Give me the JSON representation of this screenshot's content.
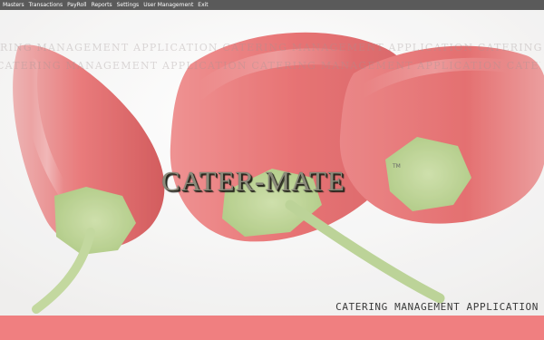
{
  "menu": {
    "items": [
      {
        "label": "Masters"
      },
      {
        "label": "Transactions"
      },
      {
        "label": "PayRoll"
      },
      {
        "label": "Reports"
      },
      {
        "label": "Settings"
      },
      {
        "label": "User Management"
      },
      {
        "label": "Exit"
      }
    ]
  },
  "branding": {
    "logo_text": "CATER-MATE",
    "trademark": "TM",
    "tagline": "CATERING MANAGEMENT APPLICATION",
    "watermark_line1": "RING MANAGEMENT APPLICATION CATERING MANAGEMENT APPLICATION CATERING MANAGEMENT APPLICATION CATERING",
    "watermark_line2": "CATERING MANAGEMENT APPLICATION CATERING MANAGEMENT APPLICATION CATERING MANAGEMENT APPLICATION CATERING"
  },
  "colors": {
    "menubar": "#5a5a5a",
    "statusbar": "#f07f80",
    "chili_red": "#d9474a",
    "stem_green": "#a9c87a"
  }
}
